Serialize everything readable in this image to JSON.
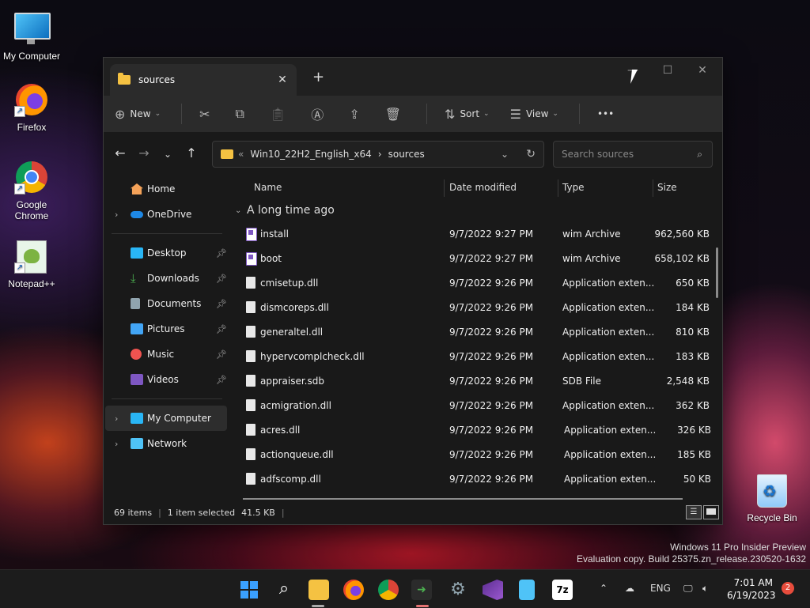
{
  "desktop": {
    "icons": [
      {
        "label": "My Computer"
      },
      {
        "label": "Firefox"
      },
      {
        "label": "Google Chrome"
      },
      {
        "label": "Notepad++"
      },
      {
        "label": "Recycle Bin"
      }
    ],
    "watermark_line1": "Windows 11 Pro Insider Preview",
    "watermark_line2": "Evaluation copy. Build 25375.zn_release.230520-1632"
  },
  "window": {
    "tab_title": "sources",
    "close_tab_glyph": "✕",
    "new_tab_glyph": "+",
    "minimize_glyph": "—",
    "maximize_glyph": "☐",
    "close_glyph": "✕"
  },
  "toolbar": {
    "new_label": "New",
    "sort_label": "Sort",
    "view_label": "View",
    "more_label": "•••"
  },
  "address": {
    "prefix": "«",
    "segment1": "Win10_22H2_English_x64",
    "separator": "›",
    "segment2": "sources",
    "search_placeholder": "Search sources"
  },
  "sidebar": {
    "home": "Home",
    "onedrive": "OneDrive",
    "desktop": "Desktop",
    "downloads": "Downloads",
    "documents": "Documents",
    "pictures": "Pictures",
    "music": "Music",
    "videos": "Videos",
    "my_computer": "My Computer",
    "network": "Network"
  },
  "columns": {
    "name": "Name",
    "date": "Date modified",
    "type": "Type",
    "size": "Size"
  },
  "group_label": "A long time ago",
  "files": [
    {
      "name": "install",
      "date": "9/7/2022 9:27 PM",
      "type": "wim Archive",
      "size": "962,560 KB",
      "icon": "wim"
    },
    {
      "name": "boot",
      "date": "9/7/2022 9:27 PM",
      "type": "wim Archive",
      "size": "658,102 KB",
      "icon": "wim"
    },
    {
      "name": "cmisetup.dll",
      "date": "9/7/2022 9:26 PM",
      "type": "Application exten...",
      "size": "650 KB",
      "icon": "dll"
    },
    {
      "name": "dismcoreps.dll",
      "date": "9/7/2022 9:26 PM",
      "type": "Application exten...",
      "size": "184 KB",
      "icon": "dll"
    },
    {
      "name": "generaltel.dll",
      "date": "9/7/2022 9:26 PM",
      "type": "Application exten...",
      "size": "810 KB",
      "icon": "dll"
    },
    {
      "name": "hypervcomplcheck.dll",
      "date": "9/7/2022 9:26 PM",
      "type": "Application exten...",
      "size": "183 KB",
      "icon": "dll"
    },
    {
      "name": "appraiser.sdb",
      "date": "9/7/2022 9:26 PM",
      "type": "SDB File",
      "size": "2,548 KB",
      "icon": "file"
    },
    {
      "name": "acmigration.dll",
      "date": "9/7/2022 9:26 PM",
      "type": "Application exten...",
      "size": "362 KB",
      "icon": "dll"
    },
    {
      "name": "acres.dll",
      "date": "9/7/2022 9:26 PM",
      "type": "Application exten...",
      "size": "326 KB",
      "icon": "dll"
    },
    {
      "name": "actionqueue.dll",
      "date": "9/7/2022 9:26 PM",
      "type": "Application exten...",
      "size": "185 KB",
      "icon": "dll"
    },
    {
      "name": "adfscomp.dll",
      "date": "9/7/2022 9:26 PM",
      "type": "Application exten...",
      "size": "50 KB",
      "icon": "dll"
    }
  ],
  "status": {
    "items": "69 items",
    "selected": "1 item selected",
    "size": "41.5 KB"
  },
  "taskbar": {
    "lang": "ENG",
    "time": "7:01 AM",
    "date": "6/19/2023",
    "notifications": "2"
  }
}
